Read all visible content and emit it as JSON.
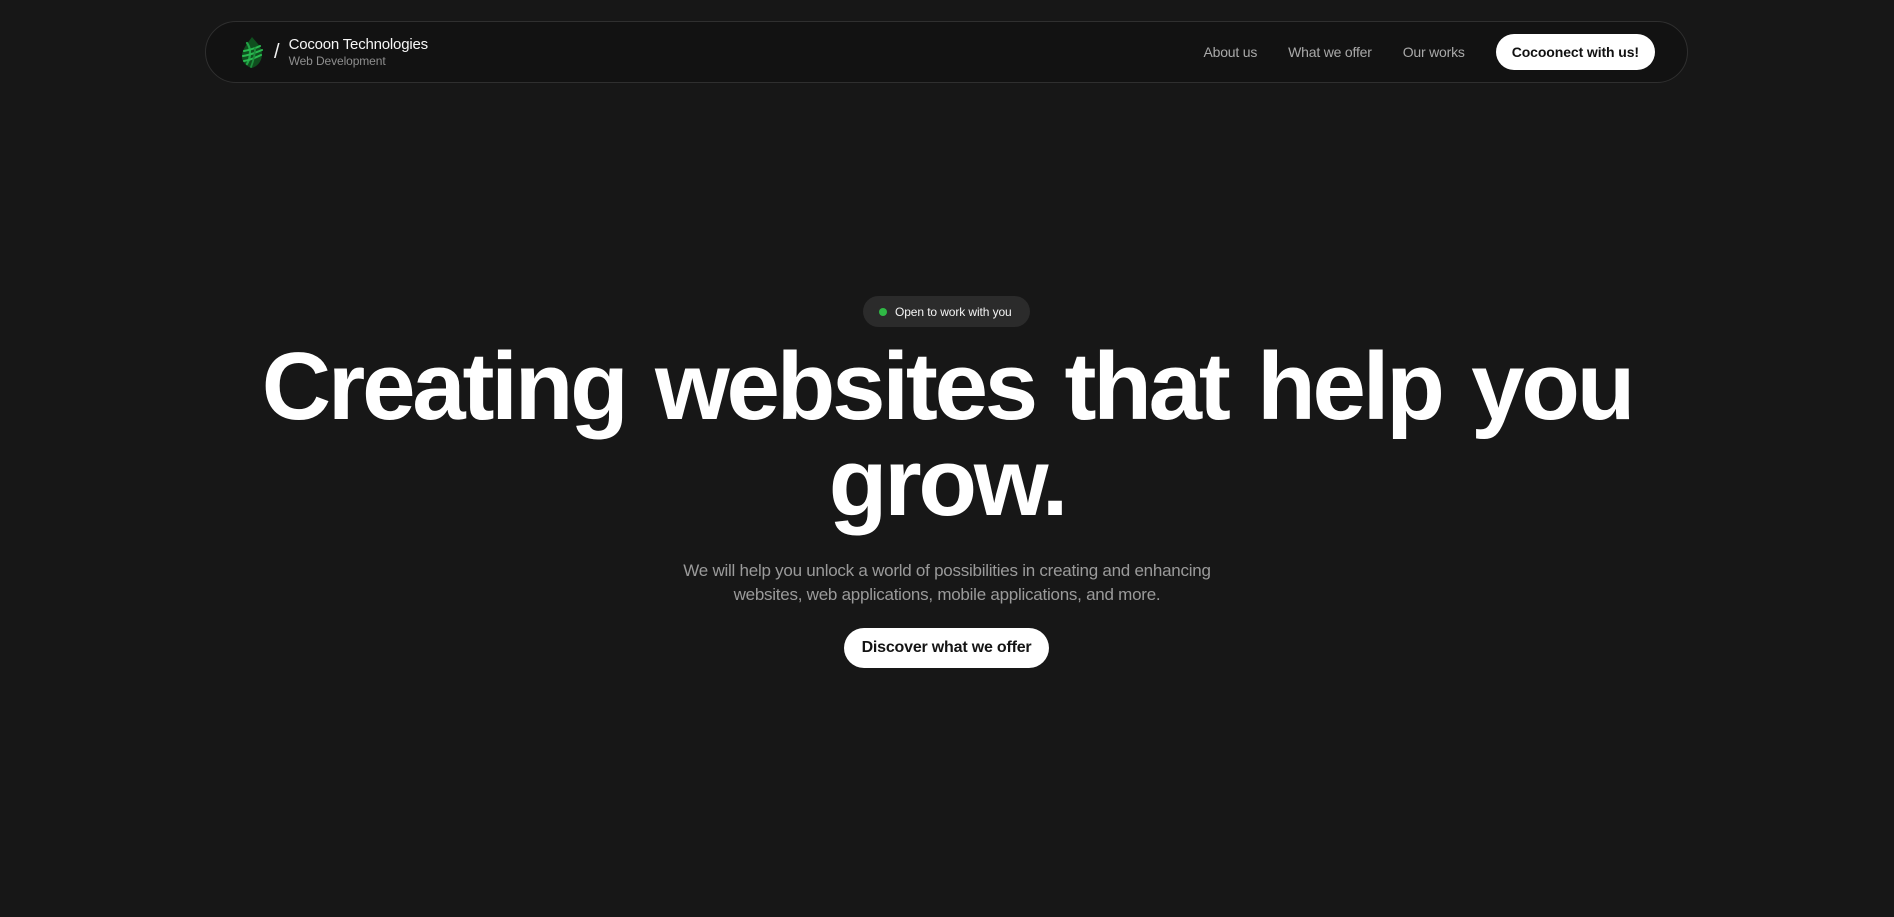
{
  "brand": {
    "logo_icon": "cocoon-leaf-icon",
    "separator": "/",
    "name": "Cocoon Technologies",
    "subtitle": "Web Development",
    "accent_color": "#1f8f3a"
  },
  "navigation": {
    "links": [
      {
        "label": "About us"
      },
      {
        "label": "What we offer"
      },
      {
        "label": "Our works"
      }
    ],
    "cta_label": "Cocoonect with us!"
  },
  "hero": {
    "status": {
      "icon": "status-dot-icon",
      "label": "Open to work with you",
      "color": "#2fb845"
    },
    "headline": "Creating websites that help you grow.",
    "description": "We will help you unlock a world of possibilities in creating and enhancing websites, web applications, mobile applications, and more.",
    "button_label": "Discover what we offer"
  },
  "colors": {
    "background": "#171717",
    "navbar_background": "#121212",
    "text_primary": "#ffffff",
    "text_muted": "#9a9a9a"
  }
}
